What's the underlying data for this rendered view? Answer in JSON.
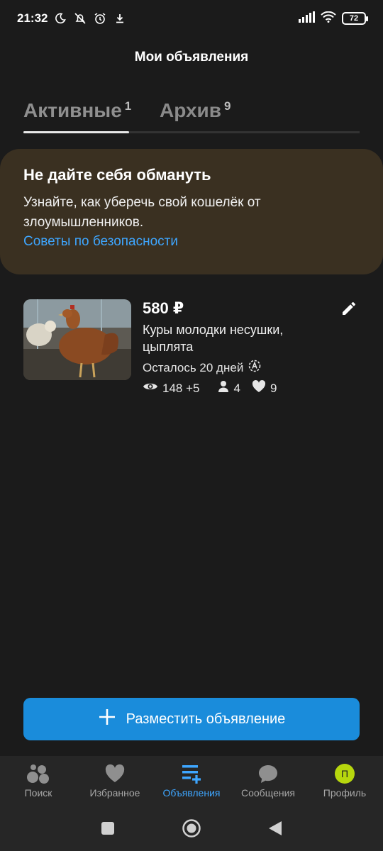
{
  "status_bar": {
    "time": "21:32",
    "battery": "72"
  },
  "header": {
    "title": "Мои объявления"
  },
  "tabs": [
    {
      "label": "Активные",
      "count": "1"
    },
    {
      "label": "Архив",
      "count": "9"
    }
  ],
  "banner": {
    "title": "Не дайте себя обмануть",
    "text": "Узнайте, как уберечь свой кошелёк от злоумышленников.",
    "link": "Советы по безопасности"
  },
  "listing": {
    "price": "580 ₽",
    "title": "Куры молодки несушки, цыплята",
    "remaining": "Осталось 20 дней",
    "views": "148 +5",
    "contacts": "4",
    "favorites": "9"
  },
  "post_button": {
    "label": "Разместить объявление"
  },
  "bottom_nav": [
    {
      "label": "Поиск"
    },
    {
      "label": "Избранное"
    },
    {
      "label": "Объявления"
    },
    {
      "label": "Сообщения"
    },
    {
      "label": "Профиль",
      "avatar_letter": "П"
    }
  ],
  "colors": {
    "background": "#1b1b1b",
    "accent": "#1a8cdb",
    "link": "#3ea6ff",
    "banner": "#3a3021",
    "avatar": "#b7d70e"
  }
}
